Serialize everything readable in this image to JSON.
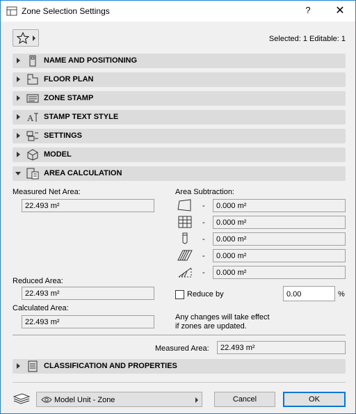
{
  "window": {
    "title": "Zone Selection Settings",
    "help": "?",
    "close": "✕"
  },
  "toolbar": {
    "selected_info": "Selected: 1 Editable: 1"
  },
  "sections": [
    {
      "label": "NAME AND POSITIONING",
      "icon": "name-positioning-icon"
    },
    {
      "label": "FLOOR PLAN",
      "icon": "floor-plan-icon"
    },
    {
      "label": "ZONE STAMP",
      "icon": "zone-stamp-icon"
    },
    {
      "label": "STAMP TEXT STYLE",
      "icon": "text-style-icon"
    },
    {
      "label": "SETTINGS",
      "icon": "settings-icon"
    },
    {
      "label": "MODEL",
      "icon": "model-icon"
    },
    {
      "label": "AREA CALCULATION",
      "icon": "area-calculation-icon"
    }
  ],
  "area": {
    "measured_net_label": "Measured Net Area:",
    "measured_net_value": "22.493 m²",
    "reduced_label": "Reduced Area:",
    "reduced_value": "22.493 m²",
    "calculated_label": "Calculated Area:",
    "calculated_value": "22.493 m²",
    "subtraction_label": "Area Subtraction:",
    "subtractions": [
      {
        "icon": "polygon-icon",
        "dash": "-",
        "value": "0.000 m²"
      },
      {
        "icon": "grid-icon",
        "dash": "-",
        "value": "0.000 m²"
      },
      {
        "icon": "column-icon",
        "dash": "-",
        "value": "0.000 m²"
      },
      {
        "icon": "hatch-icon",
        "dash": "-",
        "value": "0.000 m²"
      },
      {
        "icon": "slope-icon",
        "dash": "-",
        "value": "0.000 m²"
      }
    ],
    "reduce_by_label": "Reduce by",
    "reduce_by_value": "0.00",
    "reduce_by_unit": "%",
    "note_line1": "Any changes will take effect",
    "note_line2": "if zones are updated.",
    "measured_area_label": "Measured Area:",
    "measured_area_value": "22.493 m²"
  },
  "classification": {
    "label": "CLASSIFICATION AND PROPERTIES"
  },
  "footer": {
    "view_dropdown": "Model Unit - Zone",
    "cancel": "Cancel",
    "ok": "OK"
  }
}
